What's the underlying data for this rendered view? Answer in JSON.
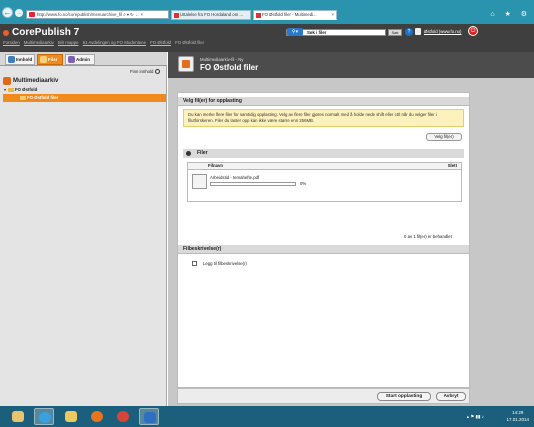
{
  "browser": {
    "url": "http://www.fo.no/corepublish/menuarchive_fil",
    "url_controls": "⌕ ▾ ↻ ← ×",
    "tabs": [
      {
        "label": "Uttalelse fra FO Hordaland om ..."
      },
      {
        "label": "FO Østfold filer - Multimedi...",
        "close": "×"
      }
    ],
    "window_controls": "⌂ ★ ⚙"
  },
  "app": {
    "title": "CorePublish 7",
    "breadcrumbs": [
      "Forsiden",
      "Multimediaarkiv",
      "Bilr mappe",
      "61 Avdelingen og FO Studentene",
      "FO Østfold",
      "FO Østfold filer"
    ],
    "search_placeholder": "Søk i filer",
    "search_button": "Søk",
    "help": "?",
    "user_link": "Østfold (www.fo.no)"
  },
  "left_panel": {
    "tabs": [
      {
        "label": "Innhold"
      },
      {
        "label": "Filer"
      },
      {
        "label": "Admin"
      }
    ],
    "find_content": "Finn innhold",
    "tree": {
      "root": "Multimediaarkiv",
      "node": "FO Østfold",
      "selected": "FO Østfold filer"
    }
  },
  "main": {
    "subtitle": "Multimediaarkiv-fil - Ny",
    "title": "FO Østfold filer",
    "upload_section": "Velg fil(er) for opplasting",
    "info_text": "Du kan merke flere filer for samtidig opplasting. Velg av flere filer gjøres normalt med å holde nede shift eller ctrl når du velger filer i filutforskeren. Filer du laster opp kan ikke være større enn 256MB.",
    "choose_button": "Velg fil(er)",
    "files_section": "Filer",
    "col_filename": "Filnavn",
    "col_delete": "Slett",
    "file": {
      "name": "Arbeidstid - temahefte.pdf",
      "progress_text": "0%",
      "progress": 0.0
    },
    "file_count": "0 av 1 fil(er) er behandlet",
    "description_section": "Filbeskrivelse(r)",
    "add_description": "Legg til filbeskrivelse(r)",
    "start_button": "Start opplasting",
    "cancel_button": "Avbryt"
  },
  "taskbar": {
    "tray": "▴ ⚑ ▮▮ ♪",
    "time": "14:29",
    "date": "17.01.2014"
  },
  "colors": {
    "accent": "#f08a1c",
    "header": "#3f3f3f",
    "browser": "#2a93ad",
    "taskbar": "#1c5f7c"
  }
}
